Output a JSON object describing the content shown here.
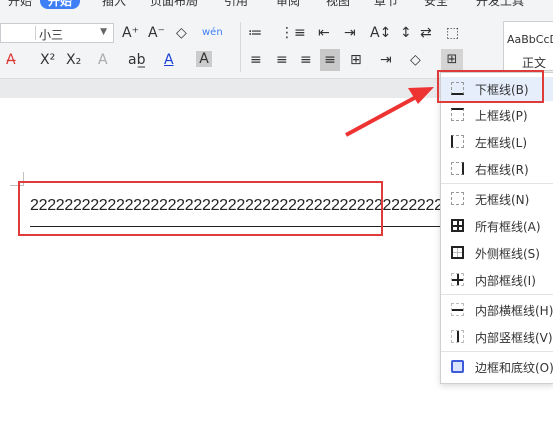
{
  "tabs": [
    "开始",
    "插入",
    "页面布局",
    "引用",
    "审阅",
    "视图",
    "章节",
    "安全",
    "开发工具"
  ],
  "active_tab": "开始",
  "font_size": {
    "value": "小三"
  },
  "toolbar": {
    "row1": [
      "A⁺",
      "A⁻",
      "◇",
      "wén",
      "≔",
      "⋮≡",
      "⇤",
      "⇥",
      "A↕",
      "↕",
      "⇄",
      "⬚"
    ],
    "row2_format": [
      "A̶",
      "X²",
      "X₂",
      "A",
      "ab̲",
      "A",
      "A"
    ],
    "row2_align": [
      "≡",
      "≡",
      "≡",
      "≡",
      "⊞"
    ]
  },
  "style_gallery": {
    "sample": "AaBbCcD",
    "name": "正文"
  },
  "document": {
    "text": "2222222222222222222222222222222222222222222222222222222"
  },
  "border_menu": {
    "items": [
      {
        "label": "下框线(B)",
        "icon": "bottom-border-icon",
        "selected": true
      },
      {
        "label": "上框线(P)",
        "icon": "top-border-icon"
      },
      {
        "label": "左框线(L)",
        "icon": "left-border-icon"
      },
      {
        "label": "右框线(R)",
        "icon": "right-border-icon"
      },
      {
        "label": "无框线(N)",
        "icon": "no-border-icon"
      },
      {
        "label": "所有框线(A)",
        "icon": "all-borders-icon"
      },
      {
        "label": "外侧框线(S)",
        "icon": "outside-borders-icon"
      },
      {
        "label": "内部框线(I)",
        "icon": "inside-borders-icon"
      },
      {
        "label": "内部横框线(H)",
        "icon": "inside-horizontal-border-icon"
      },
      {
        "label": "内部竖框线(V)",
        "icon": "inside-vertical-border-icon"
      },
      {
        "label": "边框和底纹(O)",
        "icon": "borders-and-shading-icon"
      }
    ]
  },
  "colors": {
    "accent": "#3f7ff6",
    "highlight": "#e03b3b",
    "arrow": "#ee3333"
  }
}
